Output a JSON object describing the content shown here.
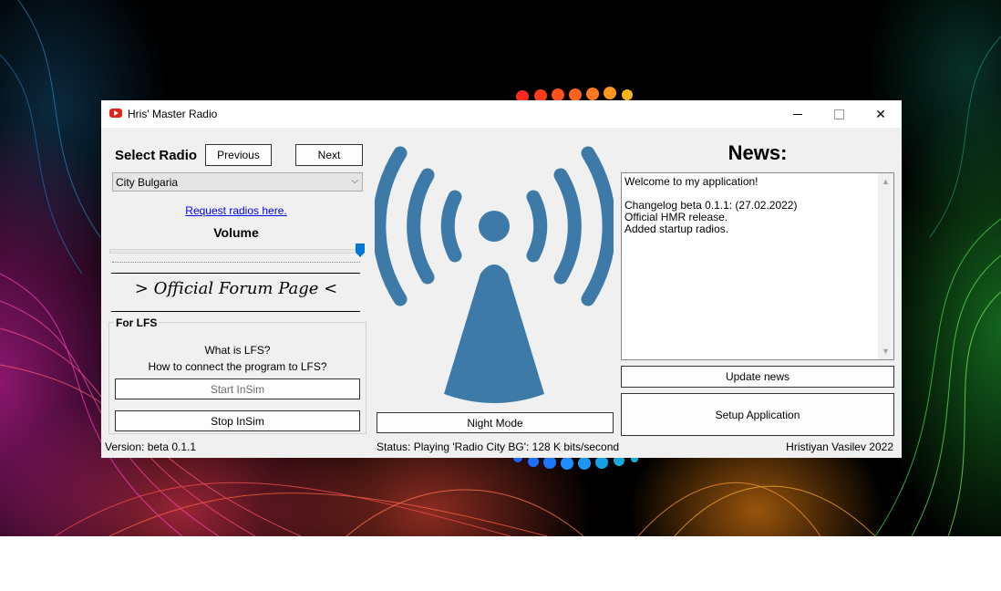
{
  "window": {
    "title": "Hris' Master Radio",
    "app_icon": "youtube-play-icon"
  },
  "titlebar": {
    "minimize_icon": "minimize-icon",
    "maximize_icon": "maximize-icon",
    "close_icon": "close-icon",
    "close_glyph": "✕"
  },
  "radio": {
    "select_label": "Select Radio",
    "previous_label": "Previous",
    "next_label": "Next",
    "selected_station": "City Bulgaria",
    "request_link": "Request radios here.",
    "volume_label": "Volume",
    "volume_level": 1.0,
    "forum_link": "> Official Forum Page <"
  },
  "lfs": {
    "group_title": "For LFS",
    "what_is": "What is LFS?",
    "how_connect": "How to connect the program to LFS?",
    "start_label": "Start InSim",
    "stop_label": "Stop InSim"
  },
  "center": {
    "tower_icon": "radio-tower-icon",
    "night_mode_label": "Night Mode",
    "tower_color": "#3d7aa8"
  },
  "news": {
    "title": "News:",
    "content": "Welcome to my application!\n\nChangelog beta 0.1.1: (27.02.2022)\nOfficial HMR release.\nAdded startup radios.",
    "update_label": "Update news",
    "setup_label": "Setup Application"
  },
  "status": {
    "version": "Version: beta 0.1.1",
    "playing": "Status: Playing 'Radio City BG': 128 K bits/second",
    "author": "Hristiyan Vasilev 2022"
  },
  "colors": {
    "accent": "#0078d7",
    "link": "#0000ee"
  }
}
